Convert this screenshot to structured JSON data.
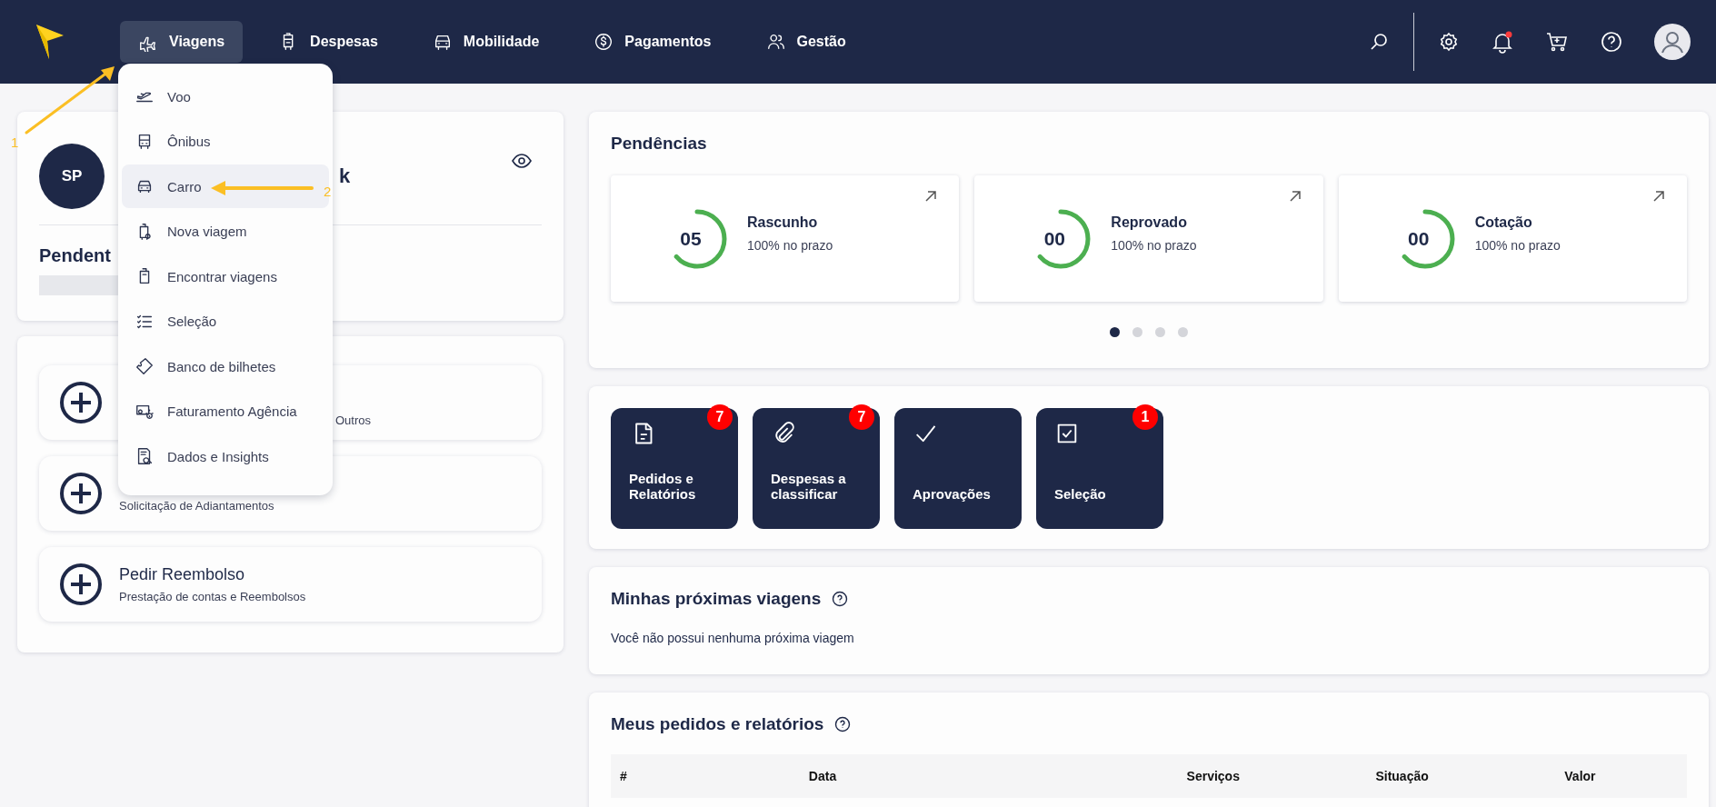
{
  "top_bar": {
    "nav": [
      {
        "label": "Viagens",
        "selected": true
      },
      {
        "label": "Despesas",
        "selected": false
      },
      {
        "label": "Mobilidade",
        "selected": false
      },
      {
        "label": "Pagamentos",
        "selected": false
      },
      {
        "label": "Gestão",
        "selected": false
      }
    ],
    "unread": true
  },
  "nav_menu": {
    "items": [
      {
        "label": "Voo",
        "selected": false
      },
      {
        "label": "Ônibus",
        "selected": false
      },
      {
        "label": "Carro",
        "selected": true
      },
      {
        "label": "Nova viagem",
        "selected": false
      },
      {
        "label": "Encontrar viagens",
        "selected": false
      },
      {
        "label": "Seleção",
        "selected": false
      },
      {
        "label": "Banco de bilhetes",
        "selected": false
      },
      {
        "label": "Faturamento Agência",
        "selected": false
      },
      {
        "label": "Dados e Insights",
        "selected": false
      }
    ]
  },
  "annotations": [
    {
      "number": "1"
    },
    {
      "number": "2"
    }
  ],
  "profile": {
    "initials": "SP",
    "name": "k",
    "pending_title": "Pendent"
  },
  "actions": [
    {
      "subtitle": "Outros"
    },
    {
      "subtitle": "Solicitação de Adiantamentos"
    },
    {
      "title": "Pedir Reembolso",
      "subtitle": "Prestação de contas e Reembolsos"
    }
  ],
  "pendencias": {
    "title": "Pendências",
    "cards": [
      {
        "count": "05",
        "label": "Rascunho",
        "note": "100% no prazo"
      },
      {
        "count": "00",
        "label": "Reprovado",
        "note": "100% no prazo"
      },
      {
        "count": "00",
        "label": "Cotação",
        "note": "100% no prazo"
      }
    ],
    "pager": [
      {
        "selected": true
      },
      {
        "selected": false
      },
      {
        "selected": false
      },
      {
        "selected": false
      }
    ]
  },
  "shortcuts": [
    {
      "label": "Pedidos e Relatórios",
      "badge": "7"
    },
    {
      "label": "Despesas a classificar",
      "badge": "7"
    },
    {
      "label": "Aprovações"
    },
    {
      "label": "Seleção",
      "badge": "1"
    }
  ],
  "upcoming": {
    "title": "Minhas próximas viagens",
    "empty_text": "Você não possui nenhuma próxima viagem"
  },
  "orders": {
    "title": "Meus pedidos e relatórios",
    "columns": [
      "#",
      "Data",
      "Serviços",
      "Situação",
      "Valor"
    ]
  }
}
